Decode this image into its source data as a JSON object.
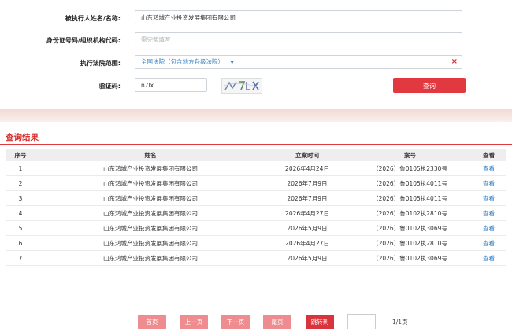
{
  "form": {
    "name_label": "被执行人姓名/名称:",
    "name_value": "山东鸿城产业投资发展集团有限公司",
    "id_label": "身份证号码/组织机构代码:",
    "id_placeholder": "需完整填写",
    "court_label": "执行法院范围:",
    "court_value": "全国法院（包含地方各级法院）",
    "court_clear": "×",
    "captcha_label": "验证码:",
    "captcha_value": "n7lx",
    "captcha_image_text": "n7lx",
    "query_label": "查询"
  },
  "results": {
    "title": "查询结果",
    "headers": [
      "序号",
      "姓名",
      "立案时间",
      "案号",
      "查看"
    ],
    "rows": [
      {
        "no": "1",
        "name": "山东鸿城产业投资发展集团有限公司",
        "date": "2026年4月24日",
        "case": "（2026）鲁0105执2330号",
        "view": "查看"
      },
      {
        "no": "2",
        "name": "山东鸿城产业投资发展集团有限公司",
        "date": "2026年7月9日",
        "case": "（2026）鲁0105执4011号",
        "view": "查看"
      },
      {
        "no": "3",
        "name": "山东鸿城产业投资发展集团有限公司",
        "date": "2026年7月9日",
        "case": "（2026）鲁0105执4011号",
        "view": "查看"
      },
      {
        "no": "4",
        "name": "山东鸿城产业投资发展集团有限公司",
        "date": "2026年4月27日",
        "case": "（2026）鲁0102执2810号",
        "view": "查看"
      },
      {
        "no": "5",
        "name": "山东鸿城产业投资发展集团有限公司",
        "date": "2026年5月9日",
        "case": "（2026）鲁0102执3069号",
        "view": "查看"
      },
      {
        "no": "6",
        "name": "山东鸿城产业投资发展集团有限公司",
        "date": "2026年4月27日",
        "case": "（2026）鲁0102执2810号",
        "view": "查看"
      },
      {
        "no": "7",
        "name": "山东鸿城产业投资发展集团有限公司",
        "date": "2026年5月9日",
        "case": "（2026）鲁0102执3069号",
        "view": "查看"
      }
    ]
  },
  "pager": {
    "first": "首页",
    "prev": "上一页",
    "next": "下一页",
    "last": "尾页",
    "jump": "跳转到",
    "count": "1/1页"
  },
  "colors": {
    "accent": "#e2383f",
    "title_red": "#d92b2b",
    "link_blue": "#2a78c2",
    "pager_light": "#ee8c8f"
  }
}
